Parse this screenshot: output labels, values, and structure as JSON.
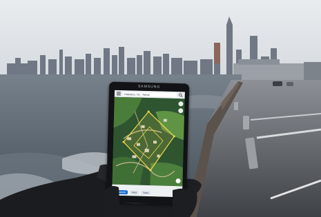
{
  "scene": {
    "description_colors": {
      "sky": "#e4e7eb",
      "water": "#55606a",
      "pier": "#4a4d51",
      "glove": "#1b1c1f"
    }
  },
  "tablet": {
    "brand": "SAMSUNG",
    "search_text": "Hoboken, NJ · Aerial",
    "info_text": "",
    "btn_primary": "Measure",
    "btn_2": "Area",
    "btn_3": "Save"
  }
}
